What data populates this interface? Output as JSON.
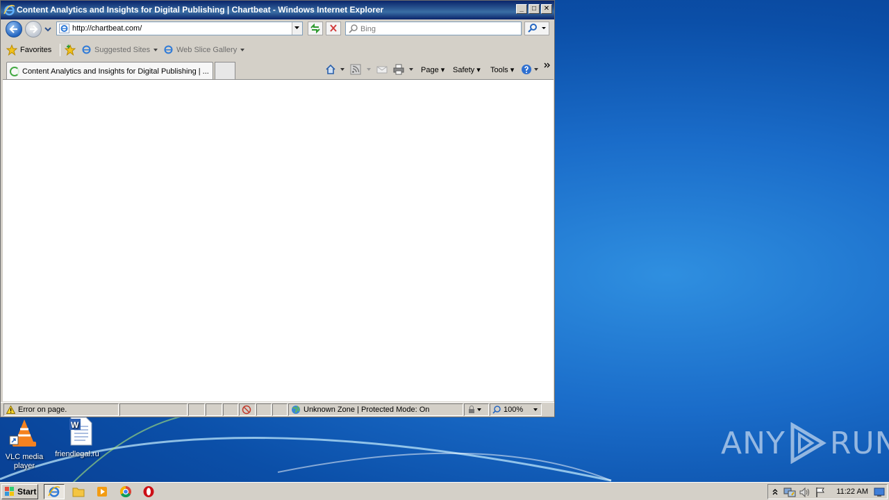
{
  "window": {
    "title": "Content Analytics and Insights for Digital Publishing | Chartbeat - Windows Internet Explorer",
    "minimize": "_",
    "maximize": "□",
    "close": "✕"
  },
  "address_bar": {
    "url": "http://chartbeat.com/"
  },
  "search": {
    "placeholder": "Bing"
  },
  "favorites_bar": {
    "favorites_label": "Favorites",
    "items": [
      {
        "label": "Suggested Sites"
      },
      {
        "label": "Web Slice Gallery"
      }
    ]
  },
  "tabs": [
    {
      "label": "Content Analytics and Insights for Digital Publishing | ..."
    }
  ],
  "command_bar": {
    "page": "Page",
    "safety": "Safety",
    "tools": "Tools"
  },
  "status_bar": {
    "message": "Error on page.",
    "zone": "Unknown Zone | Protected Mode: On",
    "zoom": "100%"
  },
  "desktop_icons": [
    {
      "label": "VLC media player",
      "icon": "vlc-icon"
    },
    {
      "label": "friendlegal.ru",
      "icon": "word-document-icon"
    }
  ],
  "watermark": {
    "text_left": "ANY",
    "text_right": "RUN"
  },
  "taskbar": {
    "start_label": "Start",
    "apps": [
      "internet-explorer-icon",
      "file-explorer-icon",
      "media-player-icon",
      "chrome-icon",
      "opera-icon"
    ],
    "clock": "11:22 AM"
  },
  "colors": {
    "desktop": "#1a6cc9",
    "titlebar": "#0a246a",
    "chrome": "#d4d0c8"
  }
}
